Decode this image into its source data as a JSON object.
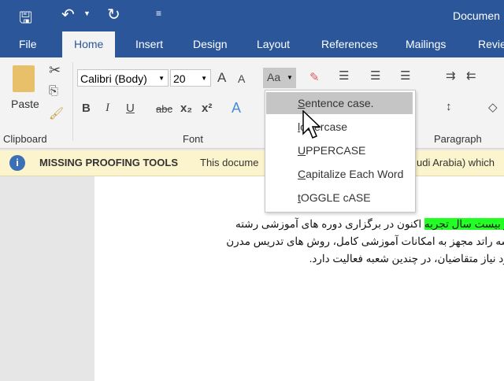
{
  "title_bar": {
    "title": "Documen",
    "quick_access": [
      "save-icon",
      "undo-icon",
      "redo-icon",
      "customize-icon"
    ]
  },
  "tabs": [
    "File",
    "Home",
    "Insert",
    "Design",
    "Layout",
    "References",
    "Mailings",
    "Revie"
  ],
  "ribbon": {
    "clipboard": {
      "paste": "Paste",
      "group": "Clipboard"
    },
    "font": {
      "name": "Calibri (Body)",
      "size": "20",
      "change_case": "Aa",
      "bold": "B",
      "italic": "I",
      "underline": "U",
      "strike": "abc",
      "subscript": "x₂",
      "superscript": "x²",
      "group": "Font"
    },
    "paragraph": {
      "group": "Paragraph"
    }
  },
  "change_case_menu": [
    {
      "first": "S",
      "rest": "entence case."
    },
    {
      "first": "l",
      "rest": "owercase"
    },
    {
      "first": "U",
      "rest": "PPERCASE"
    },
    {
      "first": "C",
      "rest": "apitalize Each Word"
    },
    {
      "first": "t",
      "rest": "OGGLE cASE"
    }
  ],
  "message_bar": {
    "title": "MISSING PROOFING TOOLS",
    "text": "This docume",
    "text_end": "udi Arabia) which"
  },
  "document": {
    "line1_highlight": "ر از بیست سال تجربه",
    "line1_rest": " اکنون در برگزاری دوره های آموزشی رشته",
    "line2": "سسه راتد مجهز به امکانات آموزشی کامل، روش های تدریس مدرن",
    "line3": "مورد نیاز متقاضیان، در چندین شعبه فعالیت دارد."
  }
}
